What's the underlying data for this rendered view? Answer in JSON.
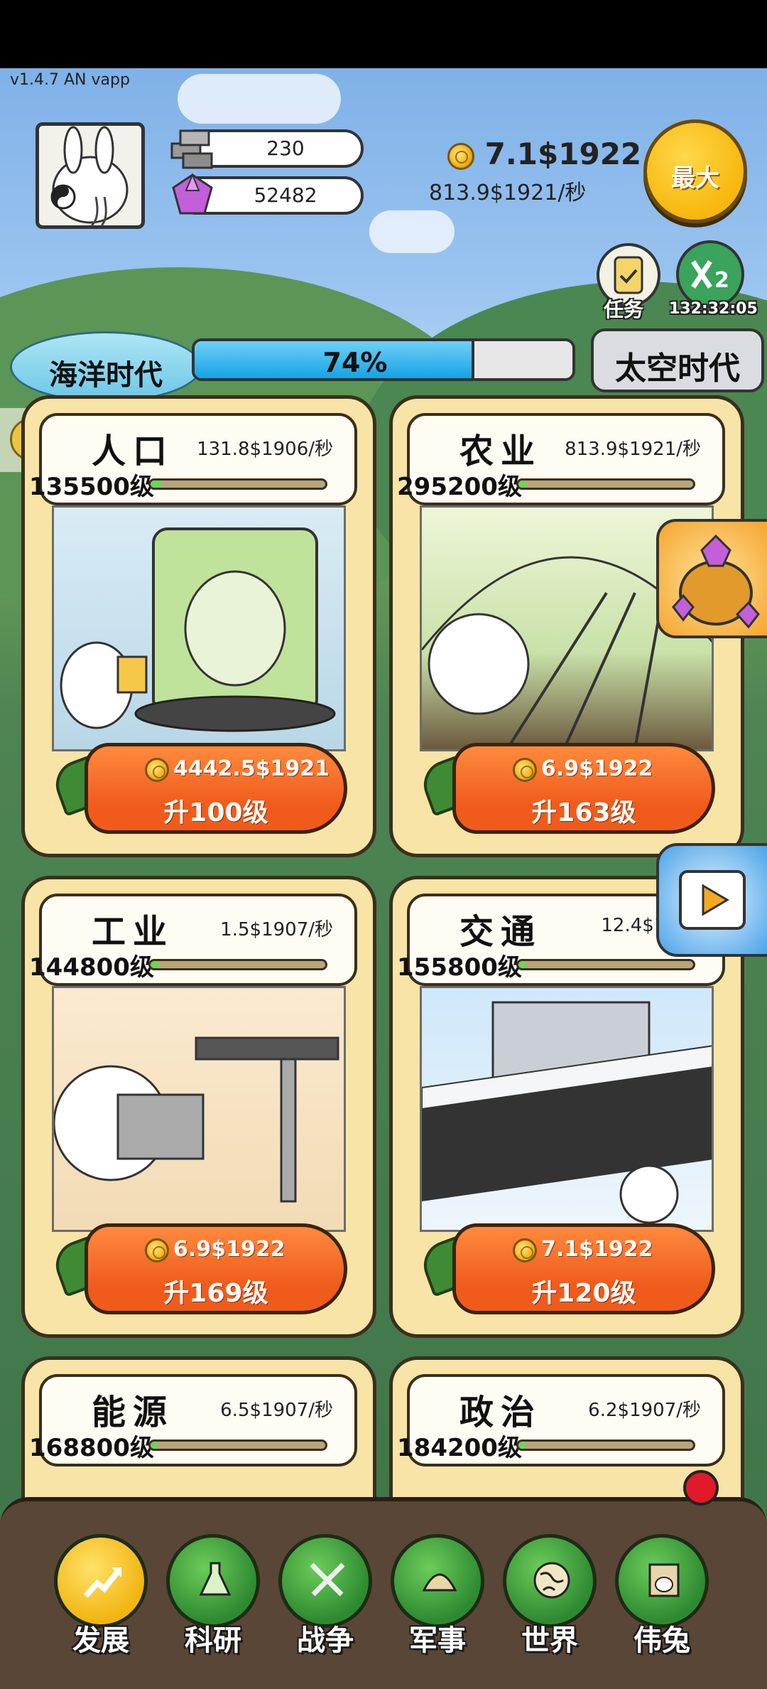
{
  "version": "v1.4.7 AN vapp",
  "resources": {
    "stone": "230",
    "gem": "52482"
  },
  "money": {
    "total": "7.1$1922",
    "rate": "813.9$1921/秒"
  },
  "max_button": "最大",
  "task_button": "任务",
  "double_timer": "132:32:05",
  "era": {
    "current": "海洋时代",
    "progress_text": "74%",
    "progress_value": 0.74,
    "next": "太空时代"
  },
  "cards": [
    {
      "title": "人口",
      "rate": "131.8$1906/秒",
      "level": "135500级",
      "cost": "4442.5$1921",
      "upgrade": "升100级"
    },
    {
      "title": "农业",
      "rate": "813.9$1921/秒",
      "level": "295200级",
      "cost": "6.9$1922",
      "upgrade": "升163级"
    },
    {
      "title": "工业",
      "rate": "1.5$1907/秒",
      "level": "144800级",
      "cost": "6.9$1922",
      "upgrade": "升169级"
    },
    {
      "title": "交通",
      "rate": "12.4$1907",
      "level": "155800级",
      "cost": "7.1$1922",
      "upgrade": "升120级"
    },
    {
      "title": "能源",
      "rate": "6.5$1907/秒",
      "level": "168800级"
    },
    {
      "title": "政治",
      "rate": "6.2$1907/秒",
      "level": "184200级"
    }
  ],
  "nav": [
    {
      "label": "发展",
      "icon": "develop-icon"
    },
    {
      "label": "科研",
      "icon": "flask-icon"
    },
    {
      "label": "战争",
      "icon": "swords-icon"
    },
    {
      "label": "军事",
      "icon": "helmet-icon"
    },
    {
      "label": "世界",
      "icon": "globe-icon"
    },
    {
      "label": "伟兔",
      "icon": "portrait-icon"
    }
  ],
  "colors": {
    "accent_orange": "#f05b1c",
    "progress_blue": "#16a3e4",
    "card_bg": "#f7e4a6",
    "nav_green": "#2e8a31",
    "nav_active": "#f2b511"
  }
}
